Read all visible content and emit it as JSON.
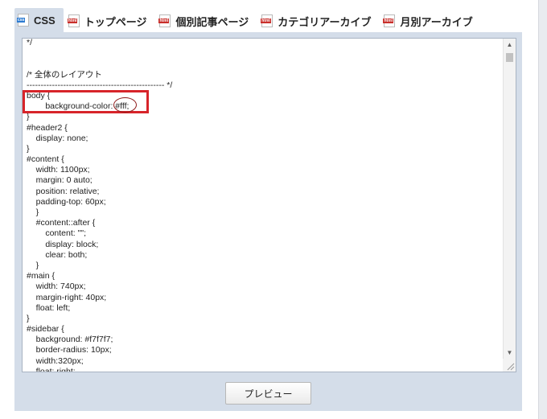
{
  "tabs": [
    {
      "label": "CSS",
      "icon": "css-file-icon",
      "icon_text": "css",
      "active": true
    },
    {
      "label": "トップページ",
      "icon": "html-file-icon",
      "icon_text": "html",
      "active": false
    },
    {
      "label": "個別記事ページ",
      "icon": "html-file-icon",
      "icon_text": "html",
      "active": false
    },
    {
      "label": "カテゴリアーカイブ",
      "icon": "html-file-icon",
      "icon_text": "html",
      "active": false
    },
    {
      "label": "月別アーカイブ",
      "icon": "html-file-icon",
      "icon_text": "html",
      "active": false
    }
  ],
  "editor": {
    "lines": [
      "*/",
      "",
      "",
      "/* 全体のレイアウト",
      "------------------------------------------------- */",
      "body {",
      "        background-color: #fff;",
      "}",
      "#header2 {",
      "    display: none;",
      "}",
      "#content {",
      "    width: 1100px;",
      "    margin: 0 auto;",
      "    position: relative;",
      "    padding-top: 60px;",
      "    }",
      "    #content::after {",
      "        content: \"\";",
      "        display: block;",
      "        clear: both;",
      "    }",
      "#main {",
      "    width: 740px;",
      "    margin-right: 40px;",
      "    float: left;",
      "}",
      "#sidebar {",
      "    background: #f7f7f7;",
      "    border-radius: 10px;",
      "    width:320px;",
      "    float: right;"
    ]
  },
  "scrollbar": {
    "up": "▲",
    "down": "▼"
  },
  "preview_button": {
    "label": "プレビュー"
  },
  "colors": {
    "panel_bg": "#d4dde9",
    "highlight_red": "#d7242a",
    "css_icon": "#2d7bd1",
    "html_icon": "#c9302c"
  }
}
